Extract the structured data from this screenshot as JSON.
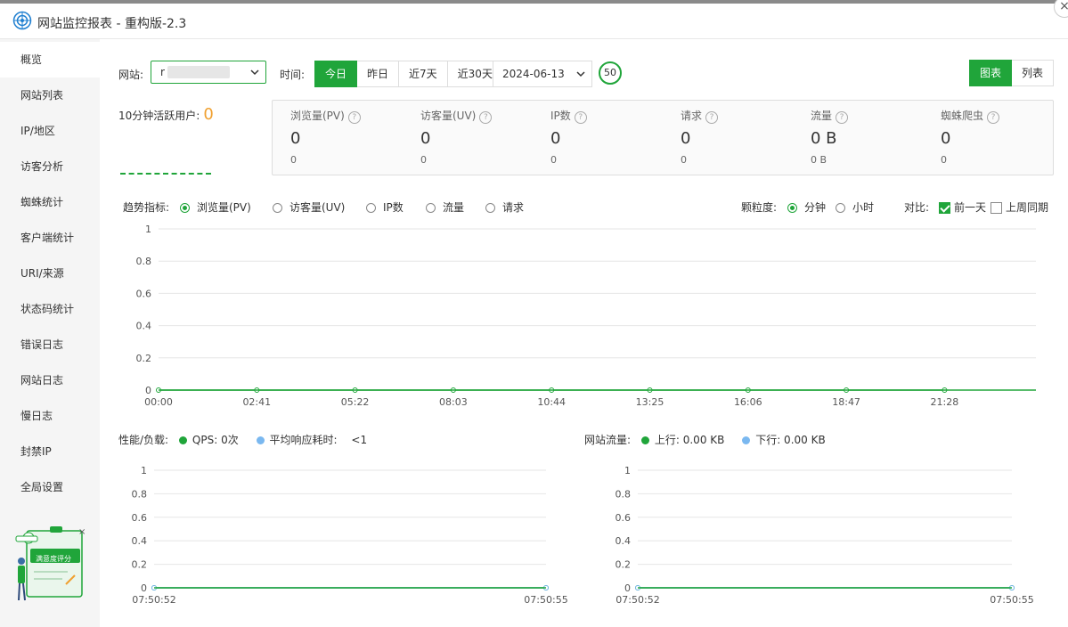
{
  "window": {
    "title": "网站监控报表 - 重构版-2.3",
    "close_label": "×"
  },
  "sidebar": {
    "items": [
      {
        "label": "概览"
      },
      {
        "label": "网站列表"
      },
      {
        "label": "IP/地区"
      },
      {
        "label": "访客分析"
      },
      {
        "label": "蜘蛛统计"
      },
      {
        "label": "客户端统计"
      },
      {
        "label": "URI/来源"
      },
      {
        "label": "状态码统计"
      },
      {
        "label": "错误日志"
      },
      {
        "label": "网站日志"
      },
      {
        "label": "慢日志"
      },
      {
        "label": "封禁IP"
      },
      {
        "label": "全局设置"
      }
    ],
    "active_index": 0,
    "badge_label": "满意度评分"
  },
  "toolbar": {
    "site_label": "网站:",
    "site_value": "r",
    "time_label": "时间:",
    "time_tabs": [
      "今日",
      "昨日",
      "近7天",
      "近30天"
    ],
    "active_tab": 0,
    "date_value": "2024-06-13",
    "refresh_count": "50",
    "view_chart": "图表",
    "view_list": "列表"
  },
  "active_users": {
    "label": "10分钟活跃用户:",
    "value": "0"
  },
  "stats": [
    {
      "name": "浏览量(PV)",
      "value": "0",
      "prev": "0"
    },
    {
      "name": "访客量(UV)",
      "value": "0",
      "prev": "0"
    },
    {
      "name": "IP数",
      "value": "0",
      "prev": "0"
    },
    {
      "name": "请求",
      "value": "0",
      "prev": "0"
    },
    {
      "name": "流量",
      "value": "0 B",
      "prev": "0 B"
    },
    {
      "name": "蜘蛛爬虫",
      "value": "0",
      "prev": "0"
    }
  ],
  "trend": {
    "label": "趋势指标:",
    "options": [
      "浏览量(PV)",
      "访客量(UV)",
      "IP数",
      "流量",
      "请求"
    ],
    "selected": 0,
    "granularity_label": "颗粒度:",
    "granularity_options": [
      "分钟",
      "小时"
    ],
    "granularity_selected": 0,
    "compare_label": "对比:",
    "compare_prev_day": "前一天",
    "compare_prev_week": "上周同期"
  },
  "perf": {
    "label": "性能/负载:",
    "qps": "QPS: 0次",
    "avg_resp_label": "平均响应耗时:",
    "avg_resp_value": "<1"
  },
  "traffic": {
    "label": "网站流量:",
    "up": "上行: 0.00 KB",
    "down": "下行: 0.00 KB"
  },
  "colors": {
    "accent": "#20a53a",
    "line_blue": "#7ab8f0",
    "warn": "#f0a030"
  },
  "chart_data": [
    {
      "type": "line",
      "title": "",
      "x": [
        "00:00",
        "02:41",
        "05:22",
        "08:03",
        "10:44",
        "13:25",
        "16:06",
        "18:47",
        "21:28"
      ],
      "series": [
        {
          "name": "浏览量(PV)",
          "values": [
            0,
            0,
            0,
            0,
            0,
            0,
            0,
            0,
            0
          ]
        }
      ],
      "yticks": [
        "0",
        "0.2",
        "0.4",
        "0.6",
        "0.8",
        "1"
      ],
      "ylim": [
        0,
        1
      ],
      "grid": true
    },
    {
      "type": "line",
      "title": "",
      "x": [
        "07:50:52",
        "07:50:55"
      ],
      "series": [
        {
          "name": "QPS",
          "values": [
            0,
            0
          ]
        },
        {
          "name": "平均响应耗时",
          "values": [
            0,
            0
          ]
        }
      ],
      "yticks": [
        "0",
        "0.2",
        "0.4",
        "0.6",
        "0.8",
        "1"
      ],
      "ylim": [
        0,
        1
      ],
      "grid": true
    },
    {
      "type": "line",
      "title": "",
      "x": [
        "07:50:52",
        "07:50:55"
      ],
      "series": [
        {
          "name": "上行",
          "values": [
            0,
            0
          ]
        },
        {
          "name": "下行",
          "values": [
            0,
            0
          ]
        }
      ],
      "yticks": [
        "0",
        "0.2",
        "0.4",
        "0.6",
        "0.8",
        "1"
      ],
      "ylim": [
        0,
        1
      ],
      "grid": true
    }
  ]
}
